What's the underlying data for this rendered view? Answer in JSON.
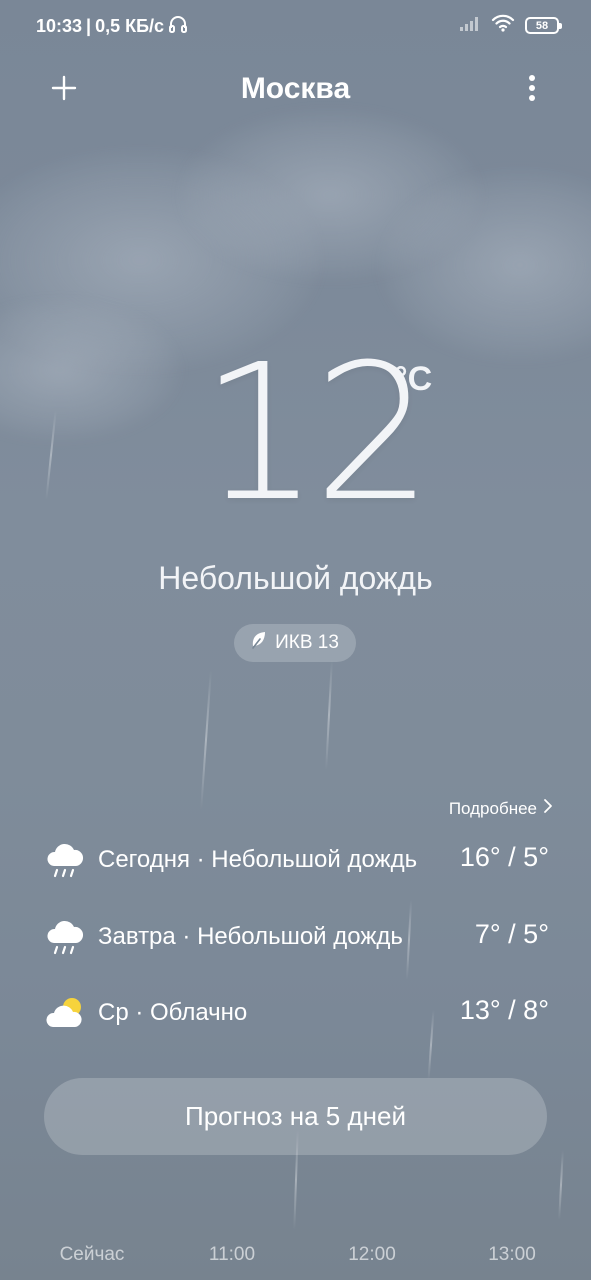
{
  "status_bar": {
    "time": "10:33",
    "separator": "|",
    "network_speed": "0,5 КБ/с",
    "headphones_icon": "headphones-icon",
    "signal_icon": "signal-icon",
    "wifi_icon": "wifi-icon",
    "battery_level": "58"
  },
  "header": {
    "add_icon": "plus-icon",
    "city": "Москва",
    "menu_icon": "more-vertical-icon"
  },
  "current": {
    "temperature": "12",
    "unit": "°C",
    "condition": "Небольшой дождь",
    "aqi_icon": "leaf-icon",
    "aqi_label": "ИКВ 13"
  },
  "forecast": {
    "more_label": "Подробнее",
    "days": [
      {
        "icon": "rain-cloud-icon",
        "label": "Сегодня · Небольшой дождь",
        "temps": "16° / 5°"
      },
      {
        "icon": "rain-cloud-icon",
        "label": "Завтра · Небольшой дождь",
        "temps": "7° / 5°"
      },
      {
        "icon": "partly-cloudy-icon",
        "label": "Ср · Облачно",
        "temps": "13° / 8°"
      }
    ]
  },
  "five_day_button": "Прогноз на 5 дней",
  "hourly": {
    "labels": [
      "Сейчас",
      "11:00",
      "12:00",
      "13:00"
    ]
  },
  "colors": {
    "background_top": "#7a8797",
    "background_bottom": "#77838f",
    "text": "#ffffff",
    "sun": "#f6d33c"
  }
}
